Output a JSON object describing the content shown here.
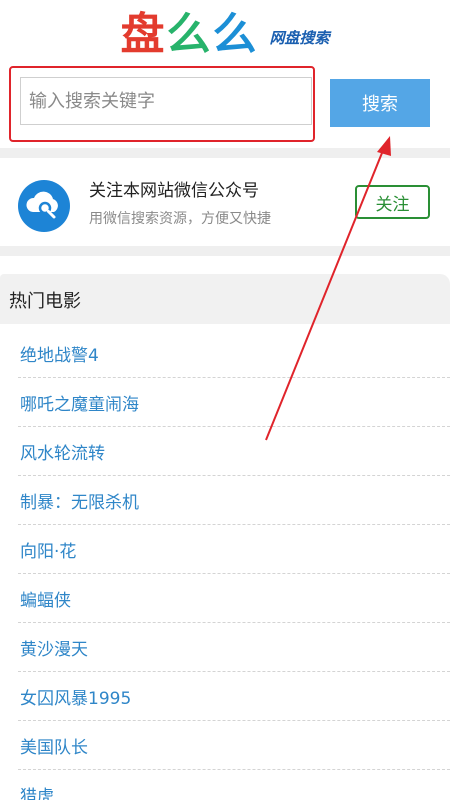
{
  "header": {
    "logo_chars": [
      "盘",
      "么",
      "么"
    ],
    "logo_subtitle": "网盘搜索"
  },
  "search": {
    "placeholder": "输入搜索关键字",
    "button_label": "搜索"
  },
  "follow": {
    "title": "关注本网站微信公众号",
    "subtitle": "用微信搜索资源，方便又快捷",
    "button_label": "关注",
    "icon": "cloud-search-icon"
  },
  "hot_movies": {
    "title": "热门电影",
    "items": [
      "绝地战警4",
      "哪吒之魔童闹海",
      "风水轮流转",
      "制暴：无限杀机",
      "向阳·花",
      "蝙蝠侠",
      "黄沙漫天",
      "女囚风暴1995",
      "美国队长",
      "猎虎"
    ]
  },
  "colors": {
    "accent_blue": "#54a6e6",
    "link_blue": "#2f86c8",
    "follow_green": "#2a8f35",
    "highlight_red": "#e0242b"
  }
}
